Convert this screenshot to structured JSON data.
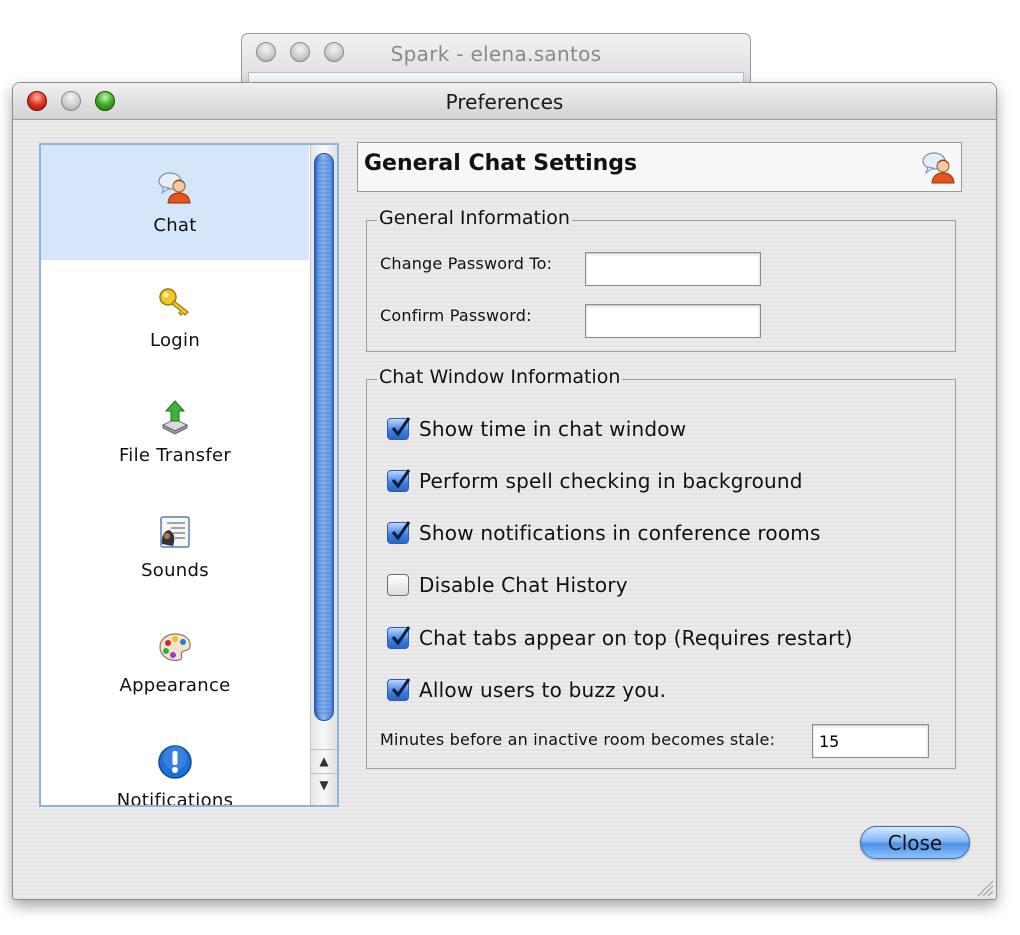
{
  "background_window": {
    "title": "Spark - elena.santos"
  },
  "window": {
    "title": "Preferences"
  },
  "sidebar": {
    "items": [
      {
        "label": "Chat",
        "icon": "chat-user-icon",
        "selected": true
      },
      {
        "label": "Login",
        "icon": "key-icon",
        "selected": false
      },
      {
        "label": "File Transfer",
        "icon": "file-transfer-icon",
        "selected": false
      },
      {
        "label": "Sounds",
        "icon": "sounds-icon",
        "selected": false
      },
      {
        "label": "Appearance",
        "icon": "palette-icon",
        "selected": false
      },
      {
        "label": "Notifications",
        "icon": "exclamation-icon",
        "selected": false
      }
    ]
  },
  "panel": {
    "title": "General Chat Settings",
    "general_info": {
      "legend": "General Information",
      "change_password_label": "Change Password To:",
      "change_password_value": "",
      "confirm_password_label": "Confirm Password:",
      "confirm_password_value": ""
    },
    "chat_window": {
      "legend": "Chat Window Information",
      "options": [
        {
          "label": "Show time in chat window",
          "checked": true
        },
        {
          "label": "Perform spell checking in background",
          "checked": true
        },
        {
          "label": "Show notifications in conference rooms",
          "checked": true
        },
        {
          "label": "Disable Chat History",
          "checked": false
        },
        {
          "label": "Chat tabs appear on top (Requires restart)",
          "checked": true
        },
        {
          "label": "Allow users to buzz you.",
          "checked": true
        }
      ],
      "stale_label": "Minutes before an inactive room becomes stale:",
      "stale_value": "15"
    }
  },
  "buttons": {
    "close": "Close"
  },
  "colors": {
    "selection": "#d6e6fa",
    "accent_blue": "#3b7fe0",
    "sidebar_border": "#8fb3d9"
  }
}
